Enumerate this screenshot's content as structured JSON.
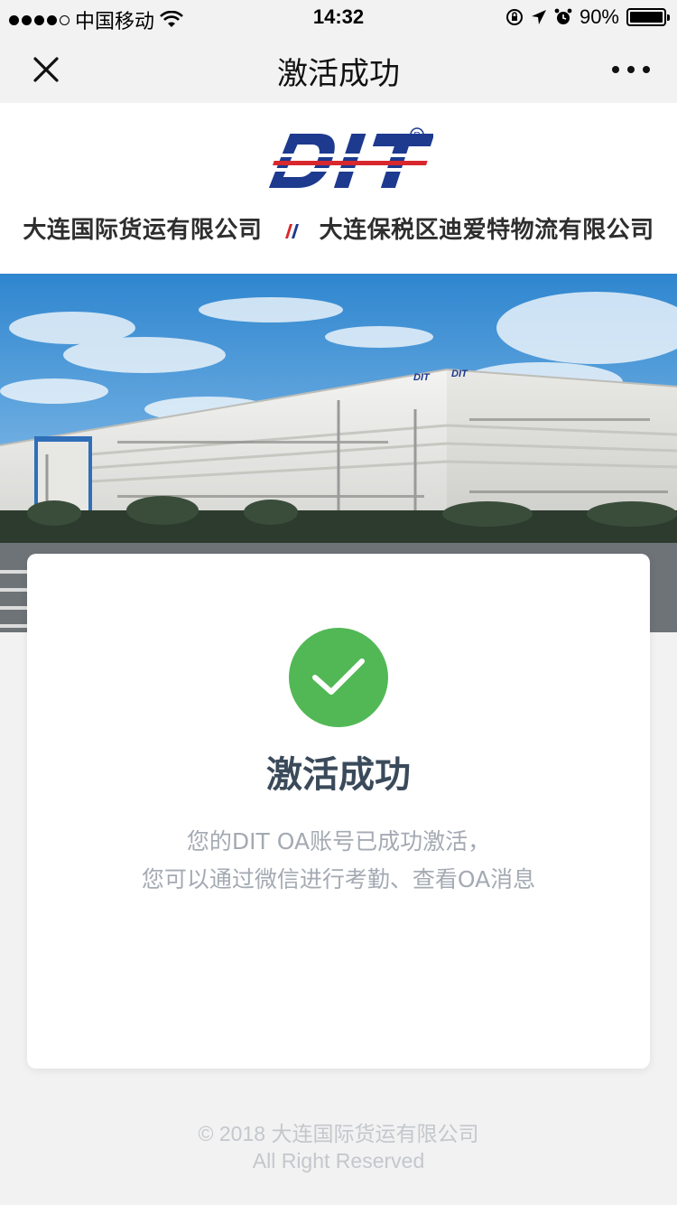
{
  "status_bar": {
    "carrier": "中国移动",
    "time": "14:32",
    "battery": "90%",
    "battery_level": 0.9,
    "signal_bars_filled": 4
  },
  "nav": {
    "title": "激活成功",
    "close_icon": "close-icon",
    "more_icon": "more-icon"
  },
  "header": {
    "logo_text": "DIT",
    "company_left": "大连国际货运有限公司",
    "company_right": "大连保税区迪爱特物流有限公司"
  },
  "banner": {
    "building_sign_1": "DIT LOGISTICS",
    "building_sign_2": "DIT LOGISTICS"
  },
  "card": {
    "icon": "check-icon",
    "title": "激活成功",
    "message_line1": "您的DIT OA账号已成功激活，",
    "message_line2": "您可以通过微信进行考勤、查看OA消息"
  },
  "footer": {
    "copyright": "© 2018 大连国际货运有限公司",
    "rights": "All Right Reserved"
  },
  "colors": {
    "success": "#52b856",
    "logo_blue": "#1d3a8f",
    "logo_red": "#d8282e"
  }
}
